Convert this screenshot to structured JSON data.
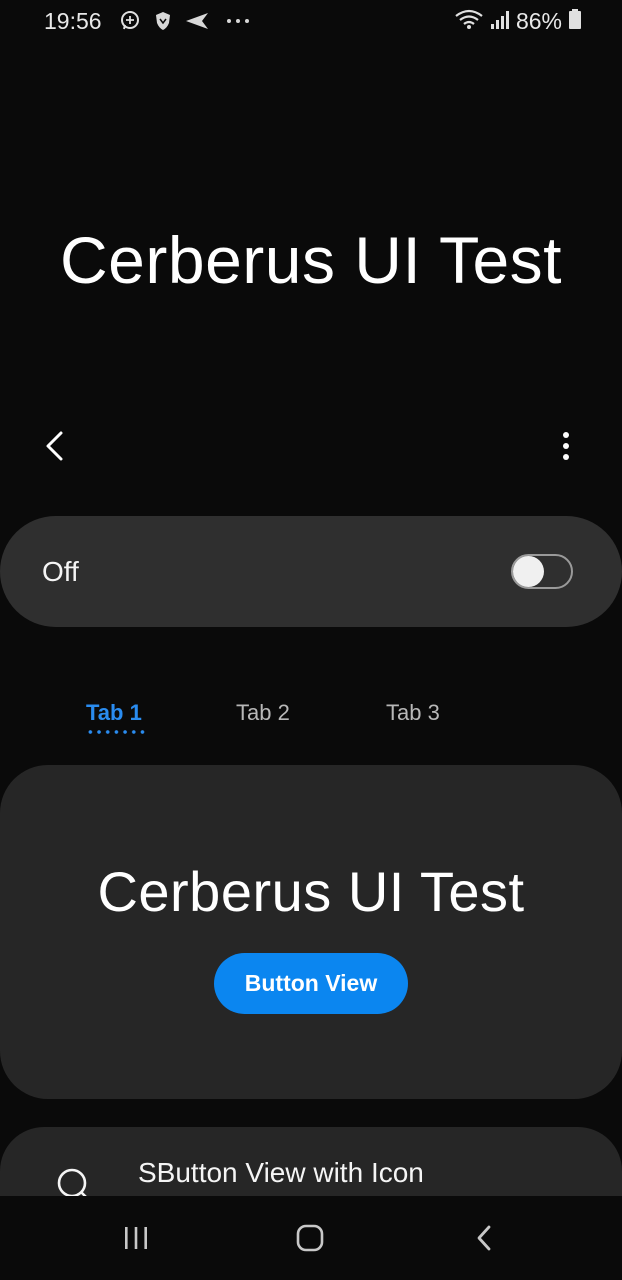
{
  "status_bar": {
    "time": "19:56",
    "icons": [
      "whatsapp-icon",
      "shield-icon",
      "send-icon",
      "more-notifications-icon"
    ],
    "battery_percent": "86%",
    "right_icons": [
      "wifi-icon",
      "signal-icon",
      "battery-icon"
    ]
  },
  "app": {
    "title": "Cerberus UI Test"
  },
  "toolbar": {
    "back_icon": "back-arrow-icon",
    "more_icon": "more-vert-icon"
  },
  "switch_bar": {
    "label": "Off",
    "checked": false
  },
  "tabs": {
    "items": [
      {
        "label": "Tab 1",
        "selected": true
      },
      {
        "label": "Tab 2",
        "selected": false
      },
      {
        "label": "Tab 3",
        "selected": false
      }
    ],
    "accent_color": "#2a8cf0"
  },
  "card": {
    "title": "Cerberus UI Test",
    "button_label": "Button View",
    "button_color": "#0b86f0"
  },
  "icon_item": {
    "label": "SButton View with Icon",
    "icon": "search-icon"
  },
  "nav_bar": {
    "icons": [
      "recents-icon",
      "home-icon",
      "back-icon"
    ]
  }
}
